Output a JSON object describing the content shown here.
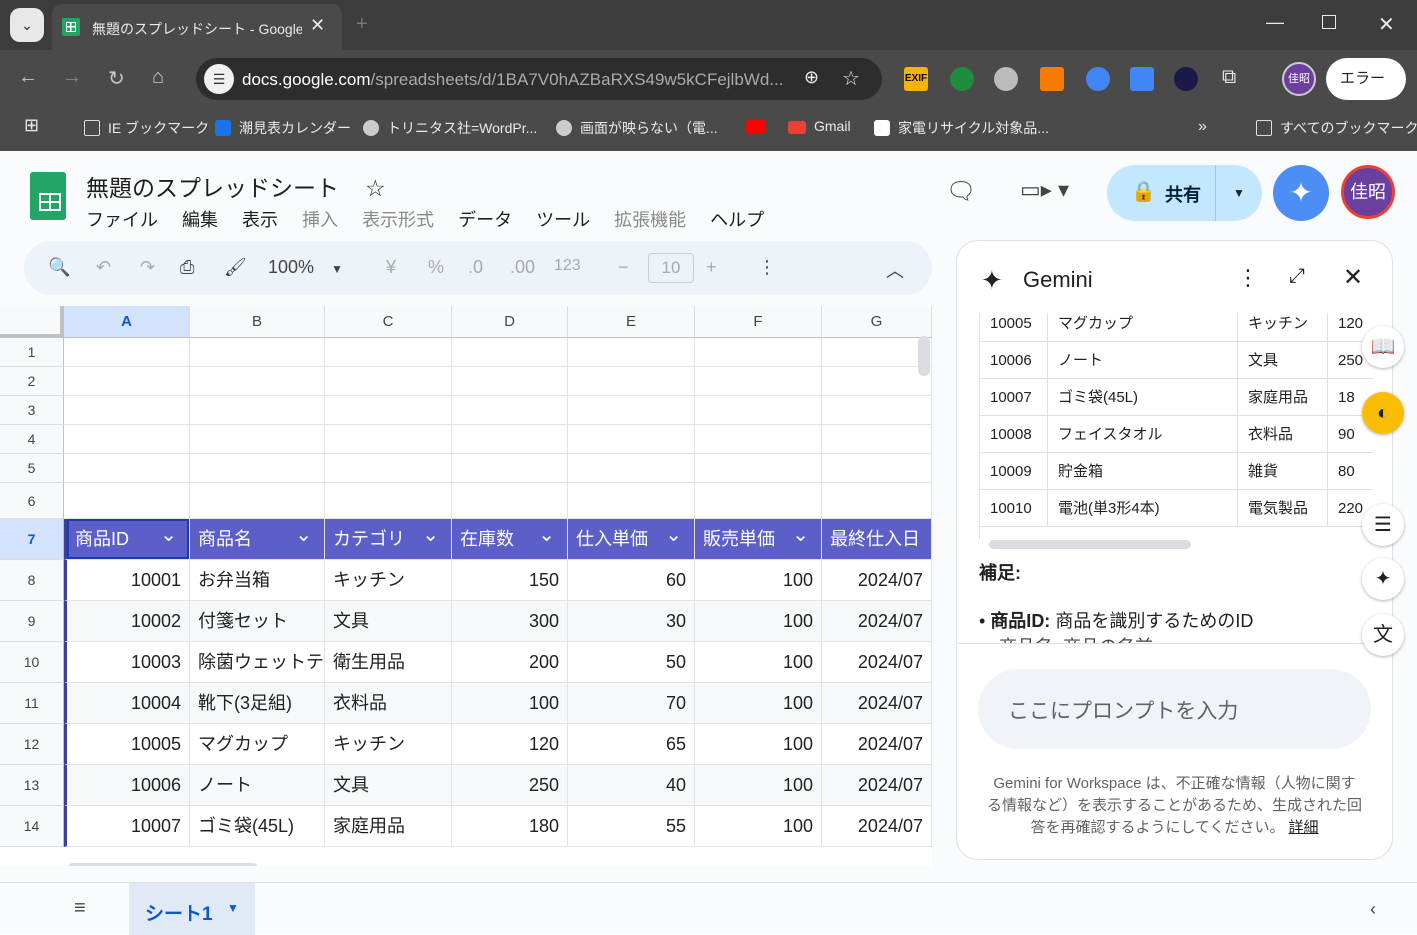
{
  "browser": {
    "tab_title": "無題のスプレッドシート - Google ス",
    "url_host": "docs.google.com",
    "url_path": "/spreadsheets/d/1BA7V0hAZBaRXS49w5kCFejlbWd...",
    "profile_label": "エラー",
    "bookmarks": [
      "IE ブックマーク",
      "潮見表カレンダー",
      "トリニタス社=WordPr...",
      "画面が映らない（電...",
      "Gmail",
      "家電リサイクル対象品..."
    ],
    "all_bookmarks": "すべてのブックマーク"
  },
  "sheets": {
    "doc_title": "無題のスプレッドシート",
    "menu": [
      "ファイル",
      "編集",
      "表示",
      "挿入",
      "表示形式",
      "データ",
      "ツール",
      "拡張機能",
      "ヘルプ"
    ],
    "share_label": "共有",
    "avatar_text": "佳昭",
    "zoom": "100%",
    "font_size": "10",
    "toolbar_symbols": [
      "¥",
      "%",
      ".0",
      ".00",
      "123"
    ],
    "columns": [
      "A",
      "B",
      "C",
      "D",
      "E",
      "F",
      "G"
    ],
    "row_numbers": [
      "1",
      "2",
      "3",
      "4",
      "5",
      "6",
      "7",
      "8",
      "9",
      "10",
      "11",
      "12",
      "13",
      "14"
    ],
    "table_headers": [
      "商品ID",
      "商品名",
      "カテゴリ",
      "在庫数",
      "仕入単価",
      "販売単価",
      "最終仕入日"
    ],
    "table_rows": [
      [
        "10001",
        "お弁当箱",
        "キッチン",
        "150",
        "60",
        "100",
        "2024/07"
      ],
      [
        "10002",
        "付箋セット",
        "文具",
        "300",
        "30",
        "100",
        "2024/07"
      ],
      [
        "10003",
        "除菌ウェットテ",
        "衛生用品",
        "200",
        "50",
        "100",
        "2024/07"
      ],
      [
        "10004",
        "靴下(3足組)",
        "衣料品",
        "100",
        "70",
        "100",
        "2024/07"
      ],
      [
        "10005",
        "マグカップ",
        "キッチン",
        "120",
        "65",
        "100",
        "2024/07"
      ],
      [
        "10006",
        "ノート",
        "文具",
        "250",
        "40",
        "100",
        "2024/07"
      ],
      [
        "10007",
        "ゴミ袋(45L)",
        "家庭用品",
        "180",
        "55",
        "100",
        "2024/07"
      ]
    ],
    "sheet_tab": "シート1"
  },
  "gemini": {
    "title": "Gemini",
    "rows": [
      [
        "10005",
        "マグカップ",
        "キッチン",
        "120"
      ],
      [
        "10006",
        "ノート",
        "文具",
        "250"
      ],
      [
        "10007",
        "ゴミ袋(45L)",
        "家庭用品",
        "18"
      ],
      [
        "10008",
        "フェイスタオル",
        "衣料品",
        "90"
      ],
      [
        "10009",
        "貯金箱",
        "雑貨",
        "80"
      ],
      [
        "10010",
        "電池(単3形4本)",
        "電気製品",
        "220"
      ]
    ],
    "note_heading": "補足:",
    "bullet_label": "商品ID:",
    "bullet_text": "商品を識別するためのID",
    "bullet2": "商品名: 商品の名前",
    "prompt_placeholder": "ここにプロンプトを入力",
    "disclaimer": "Gemini for Workspace は、不正確な情報（人物に関する情報など）を表示することがあるため、生成された回答を再確認するようにしてください。",
    "details_link": "詳細"
  }
}
